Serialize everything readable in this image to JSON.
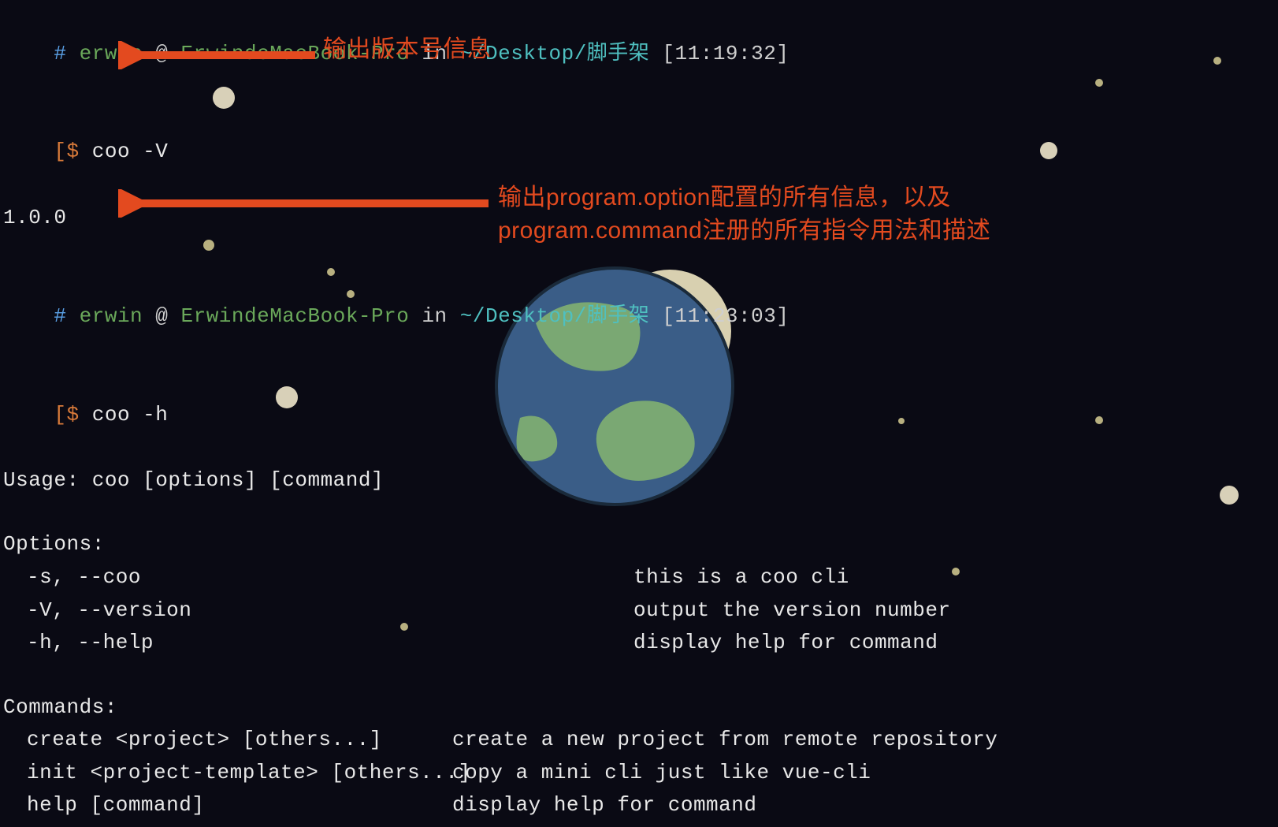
{
  "prompt1": {
    "hash": "#",
    "user": "erwin",
    "at": "@",
    "host": "ErwindeMacBook-Pro",
    "in": "in",
    "path": "~/Desktop/脚手架",
    "time": "[11:19:32]",
    "dollar": "[$",
    "command": "coo -V",
    "output": "1.0.0"
  },
  "prompt2": {
    "hash": "#",
    "user": "erwin",
    "at": "@",
    "host": "ErwindeMacBook-Pro",
    "in": "in",
    "path": "~/Desktop/脚手架",
    "time": "[11:23:03]",
    "dollar": "[$",
    "command": "coo -h"
  },
  "usage": "Usage: coo [options] [command]",
  "options_header": "Options:",
  "options": [
    {
      "flags": "-s, --coo",
      "desc": "this is a coo cli"
    },
    {
      "flags": "-V, --version",
      "desc": "output the version number"
    },
    {
      "flags": "-h, --help",
      "desc": "display help for command"
    }
  ],
  "commands_header": "Commands:",
  "commands": [
    {
      "cmd": "create <project> [others...]",
      "desc": "create a new project from remote repository"
    },
    {
      "cmd": "init <project-template> [others...]",
      "desc": "copy a mini cli just like vue-cli"
    },
    {
      "cmd": "help [command]",
      "desc": "display help for command"
    }
  ],
  "annotations": {
    "version_note": "输出版本号信息",
    "help_note": "输出program.option配置的所有信息，以及program.command注册的所有指令用法和描述"
  },
  "colors": {
    "annotation": "#e34a1f",
    "user": "#6aa85a",
    "path": "#4fc0c0",
    "hash": "#5aa0e6",
    "dollar": "#d87a3a"
  }
}
